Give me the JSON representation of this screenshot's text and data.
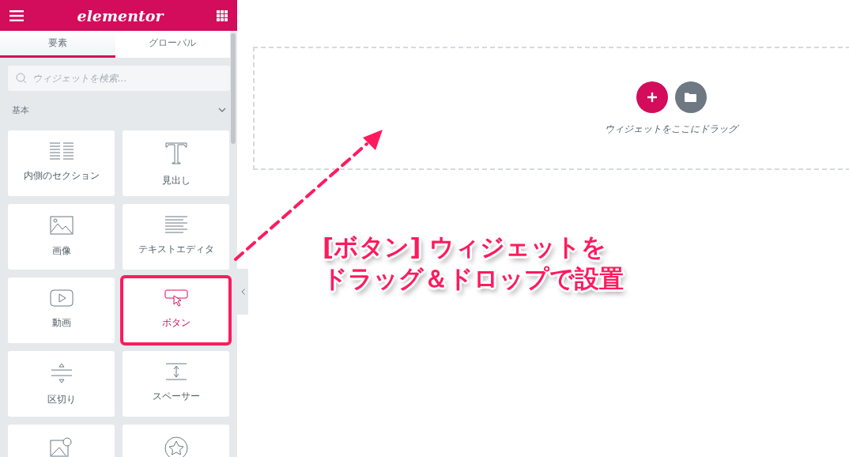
{
  "header": {
    "logo": "elementor"
  },
  "tabs": [
    {
      "label": "要素",
      "selected": true
    },
    {
      "label": "グローバル",
      "selected": false
    }
  ],
  "search": {
    "placeholder": "ウィジェットを検索..."
  },
  "category": {
    "title": "基本",
    "expanded": true
  },
  "widgets": [
    {
      "kind": "inner-section",
      "label": "内側のセクション",
      "highlighted": false
    },
    {
      "kind": "heading",
      "label": "見出し",
      "highlighted": false
    },
    {
      "kind": "image",
      "label": "画像",
      "highlighted": false
    },
    {
      "kind": "text-editor",
      "label": "テキストエディタ",
      "highlighted": false
    },
    {
      "kind": "video",
      "label": "動画",
      "highlighted": false
    },
    {
      "kind": "button",
      "label": "ボタン",
      "highlighted": true
    },
    {
      "kind": "divider",
      "label": "区切り",
      "highlighted": false
    },
    {
      "kind": "spacer",
      "label": "スペーサー",
      "highlighted": false
    },
    {
      "kind": "map",
      "highlighted": false
    },
    {
      "kind": "star",
      "highlighted": false
    }
  ],
  "canvas": {
    "drop_hint": "ウィジェットをここにドラッグ"
  },
  "annotation": {
    "lines": [
      "[ボタン] ウィジェットを",
      "ドラッグ＆ドロップで設置"
    ]
  }
}
